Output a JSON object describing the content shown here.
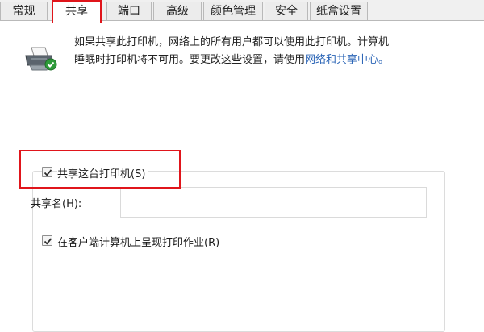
{
  "tabs": [
    "常规",
    "共享",
    "端口",
    "高级",
    "颜色管理",
    "安全",
    "纸盒设置"
  ],
  "active_tab": "共享",
  "sharing": {
    "description_line1": "如果共享此打印机，网络上的所有用户都可以使用此打印机。计算机",
    "description_line2": "睡眠时打印机将不可用。要更改这些设置，请使用",
    "network_center_link": "网络和共享中心。",
    "share_checkbox_label": "共享这台打印机(S)",
    "share_checked": true,
    "share_name_label": "共享名(H):",
    "share_name_value": "",
    "render_checkbox_label": "在客户端计算机上呈现打印作业(R)",
    "render_checked": true
  },
  "icons": {
    "printer": "printer-shared-icon",
    "checkmark": "checkmark-icon"
  },
  "colors": {
    "highlight": "#e0151b",
    "link": "#2a64b6",
    "shared_badge": "#2e9b3a"
  }
}
